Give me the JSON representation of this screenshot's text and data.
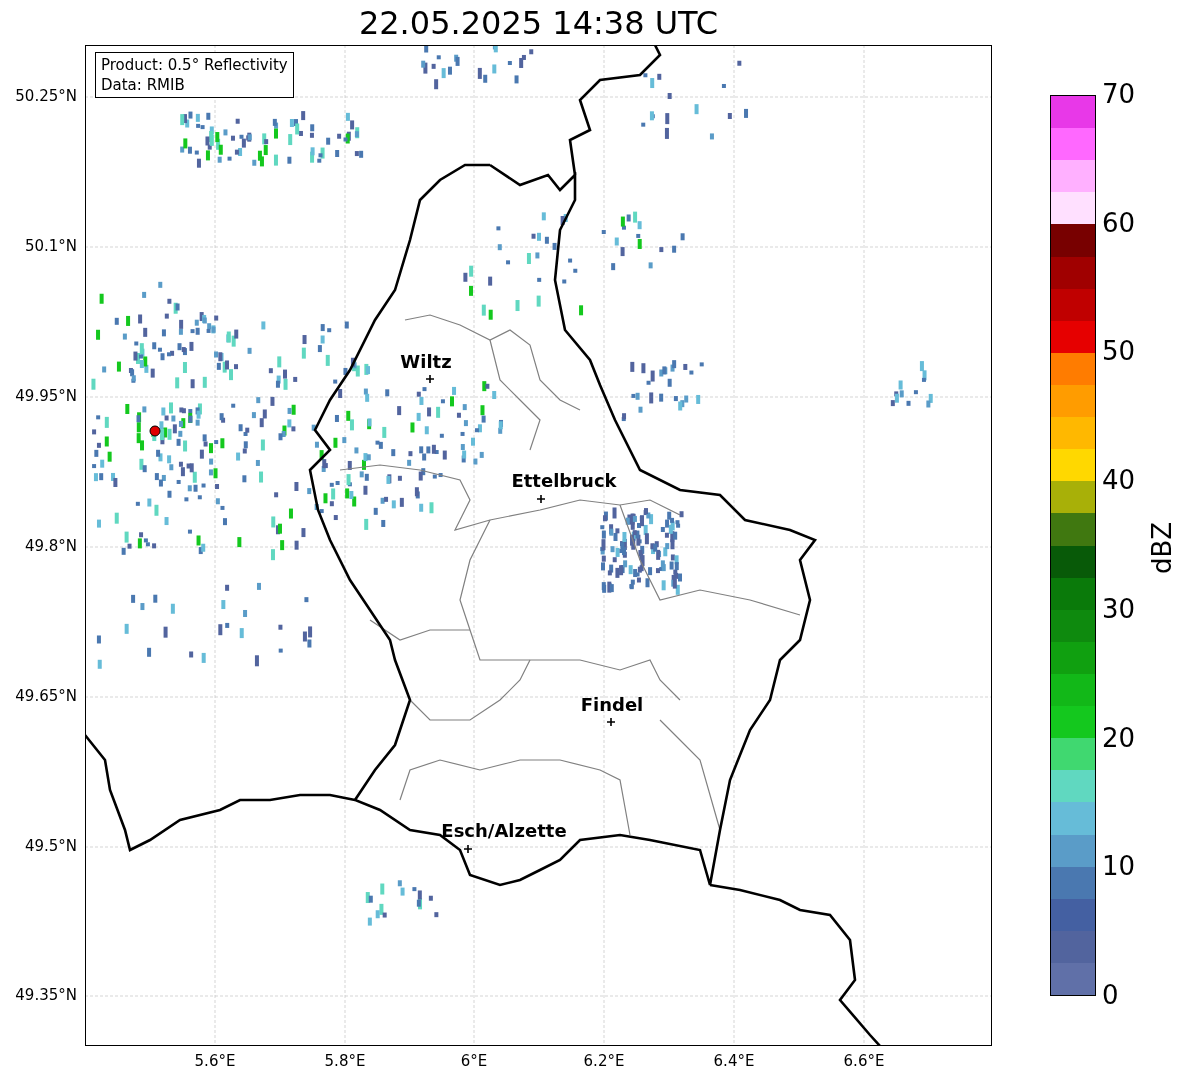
{
  "title": "22.05.2025 14:38 UTC",
  "legend": {
    "lines": [
      "Product: 0.5° Reflectivity",
      "Data: RMIB"
    ]
  },
  "map": {
    "yticks": [
      "50.25°N",
      "50.1°N",
      "49.95°N",
      "49.8°N",
      "49.65°N",
      "49.5°N",
      "49.35°N"
    ],
    "xticks": [
      "5.6°E",
      "5.8°E",
      "6°E",
      "6.2°E",
      "6.4°E",
      "6.6°E"
    ],
    "cities": [
      {
        "name": "Wiltz"
      },
      {
        "name": "Ettelbruck"
      },
      {
        "name": "Findel"
      },
      {
        "name": "Esch/Alzette"
      }
    ]
  },
  "colorbar": {
    "label": "dBZ",
    "ticks": [
      "70",
      "60",
      "50",
      "40",
      "30",
      "20",
      "10",
      "0"
    ],
    "bands": [
      {
        "color": "#e838e8"
      },
      {
        "color": "#ff68ff"
      },
      {
        "color": "#ffb0ff"
      },
      {
        "color": "#ffe0ff"
      },
      {
        "color": "#780000"
      },
      {
        "color": "#a00000"
      },
      {
        "color": "#c00000"
      },
      {
        "color": "#e60000"
      },
      {
        "color": "#ff7c00"
      },
      {
        "color": "#ff9c00"
      },
      {
        "color": "#ffb800"
      },
      {
        "color": "#ffd800"
      },
      {
        "color": "#a8b008"
      },
      {
        "color": "#407810"
      },
      {
        "color": "#085a08"
      },
      {
        "color": "#0a7a0a"
      },
      {
        "color": "#0e8a0e"
      },
      {
        "color": "#10a010"
      },
      {
        "color": "#12b818"
      },
      {
        "color": "#14c81e"
      },
      {
        "color": "#40d870"
      },
      {
        "color": "#60d8c0"
      },
      {
        "color": "#66bcd8"
      },
      {
        "color": "#5a9cc8"
      },
      {
        "color": "#4a78b0"
      },
      {
        "color": "#4460a2"
      },
      {
        "color": "#52649e"
      },
      {
        "color": "#6070a8"
      }
    ]
  }
}
